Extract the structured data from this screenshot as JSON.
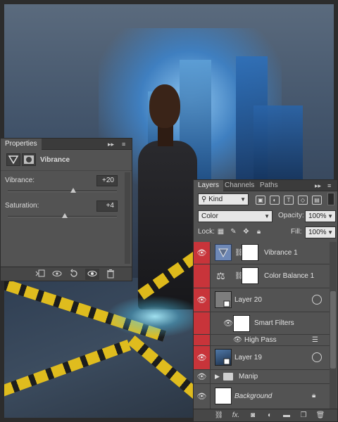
{
  "properties": {
    "tab_label": "Properties",
    "adjustment_name": "Vibrance",
    "vibrance": {
      "label": "Vibrance:",
      "value": "+20",
      "level": 0.6
    },
    "saturation": {
      "label": "Saturation:",
      "value": "+4",
      "level": 0.52
    },
    "collapse_glyph": "▸▸",
    "menu_glyph": "≡"
  },
  "layers": {
    "tabs": [
      "Layers",
      "Channels",
      "Paths"
    ],
    "filter_kind": "Kind",
    "blend_mode": "Color",
    "opacity_label": "Opacity:",
    "opacity_value": "100%",
    "lock_label": "Lock:",
    "fill_label": "Fill:",
    "fill_value": "100%",
    "rows": [
      {
        "name": "Vibrance 1",
        "selected": true,
        "vis_red": true
      },
      {
        "name": "Color Balance 1",
        "selected": false,
        "vis_red": true
      },
      {
        "name": "Layer 20",
        "selected": false,
        "vis_red": true
      },
      {
        "name": "Smart Filters",
        "selected": false,
        "vis_red": true
      },
      {
        "name": "High Pass",
        "selected": false,
        "vis_red": true
      },
      {
        "name": "Layer 19",
        "selected": false,
        "vis_red": true
      },
      {
        "name": "Manip",
        "selected": false,
        "vis_red": false
      },
      {
        "name": "Background",
        "selected": false,
        "vis_red": false
      }
    ],
    "footer_icons": [
      "link-icon",
      "fx-icon",
      "mask-icon",
      "adjustment-icon",
      "folder-icon",
      "new-layer-icon",
      "trash-icon"
    ],
    "footer_fx_label": "fx."
  },
  "colors": {
    "selected_row": "#6e88b6",
    "visibility_red": "#c8343a",
    "panel_bg": "#535353",
    "caution_tape": "#e8c21b"
  }
}
